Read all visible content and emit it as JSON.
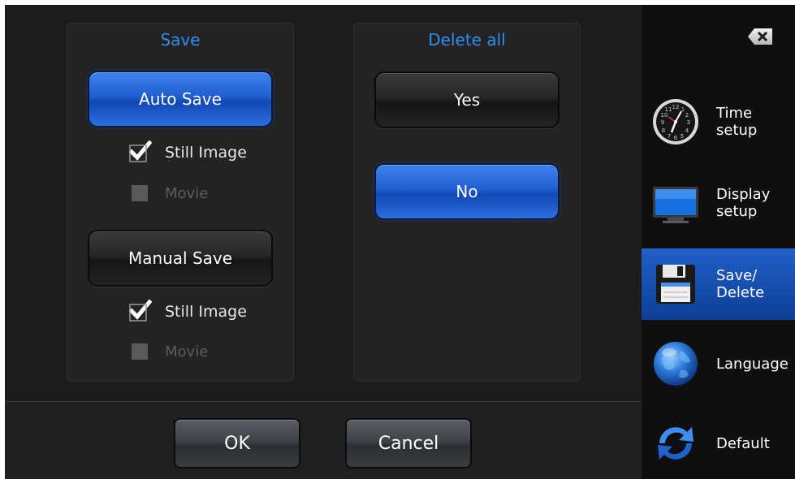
{
  "save_panel": {
    "title": "Save",
    "auto_save": {
      "label": "Auto Save",
      "options": [
        {
          "label": "Still Image",
          "checked": true
        },
        {
          "label": "Movie",
          "checked": false
        }
      ]
    },
    "manual_save": {
      "label": "Manual Save",
      "options": [
        {
          "label": "Still Image",
          "checked": true
        },
        {
          "label": "Movie",
          "checked": false
        }
      ]
    }
  },
  "delete_panel": {
    "title": "Delete all",
    "yes_label": "Yes",
    "no_label": "No"
  },
  "footer": {
    "ok_label": "OK",
    "cancel_label": "Cancel"
  },
  "sidebar": {
    "items": [
      {
        "label": "Time setup",
        "icon": "clock-icon"
      },
      {
        "label": "Display\nsetup",
        "icon": "monitor-icon"
      },
      {
        "label": "Save/\nDelete",
        "icon": "floppy-disk-icon",
        "active": true
      },
      {
        "label": "Language",
        "icon": "globe-icon"
      },
      {
        "label": "Default",
        "icon": "refresh-icon"
      }
    ]
  },
  "colors": {
    "accent_blue": "#2f8ff0",
    "button_blue": "#1f5fd0",
    "background": "#1c1c1c"
  }
}
